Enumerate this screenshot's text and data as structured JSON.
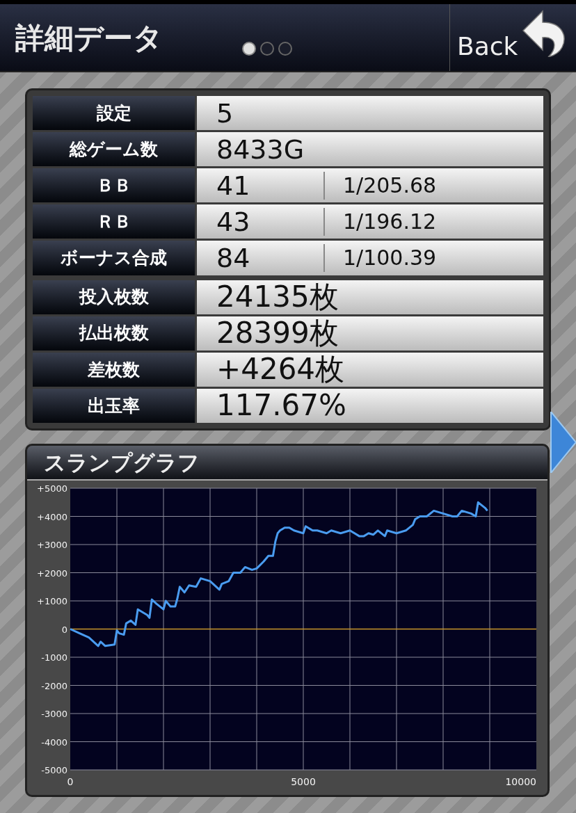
{
  "header": {
    "title": "詳細データ",
    "pages": [
      {
        "selected": true
      },
      {
        "selected": false
      },
      {
        "selected": false
      }
    ],
    "back_button": "Back"
  },
  "table": {
    "rows": [
      {
        "label": "設定",
        "value": "5",
        "kind": "game"
      },
      {
        "label": "総ゲーム数",
        "value": "8433G",
        "kind": "game"
      },
      {
        "label": "ＢＢ",
        "value": "41",
        "ratio": "1/205.68",
        "kind": "game"
      },
      {
        "label": "ＲＢ",
        "value": "43",
        "ratio": "1/196.12",
        "kind": "game"
      },
      {
        "label": "ボーナス合成",
        "value": "84",
        "ratio": "1/100.39",
        "kind": "game"
      },
      {
        "label": "投入枚数",
        "value": "24135枚",
        "kind": "medal"
      },
      {
        "label": "払出枚数",
        "value": "28399枚",
        "kind": "medal"
      },
      {
        "label": "差枚数",
        "value": "+4264枚",
        "kind": "medal"
      },
      {
        "label": "出玉率",
        "value": "117.67%",
        "kind": "medal"
      }
    ]
  },
  "graph": {
    "title": "スランプグラフ",
    "chart_data": {
      "type": "line",
      "grid": true,
      "ref_lines": [
        {
          "axis": "y",
          "value": 0,
          "color": "#c8962a"
        }
      ],
      "xlim": [
        0,
        10000
      ],
      "ylim": [
        -5000,
        5000
      ],
      "xticks": [
        0,
        5000,
        10000
      ],
      "yticks": [
        {
          "value": 5000,
          "label": "+5000"
        },
        {
          "value": 4000,
          "label": "+4000"
        },
        {
          "value": 3000,
          "label": "+3000"
        },
        {
          "value": 2000,
          "label": "+2000"
        },
        {
          "value": 1000,
          "label": "+1000"
        },
        {
          "value": 0,
          "label": "0"
        },
        {
          "value": -1000,
          "label": "-1000"
        },
        {
          "value": -2000,
          "label": "-2000"
        },
        {
          "value": -3000,
          "label": "-3000"
        },
        {
          "value": -4000,
          "label": "-4000"
        },
        {
          "value": -5000,
          "label": "-5000"
        }
      ],
      "x": [
        0,
        200,
        400,
        600,
        650,
        750,
        950,
        1000,
        1050,
        1150,
        1200,
        1300,
        1400,
        1450,
        1650,
        1700,
        1750,
        1850,
        2000,
        2050,
        2150,
        2250,
        2300,
        2350,
        2450,
        2550,
        2700,
        2800,
        3000,
        3200,
        3250,
        3400,
        3500,
        3650,
        3750,
        3900,
        4000,
        4150,
        4250,
        4350,
        4400,
        4450,
        4500,
        4600,
        4700,
        4800,
        5000,
        5050,
        5200,
        5300,
        5500,
        5600,
        5800,
        6000,
        6200,
        6300,
        6400,
        6500,
        6600,
        6750,
        6800,
        7000,
        7200,
        7350,
        7400,
        7500,
        7650,
        7800,
        8000,
        8200,
        8300,
        8400,
        8600,
        8700,
        8750,
        8900,
        8950
      ],
      "series": [
        {
          "color": "#4a9cf0",
          "values": [
            0,
            -150,
            -300,
            -600,
            -450,
            -600,
            -550,
            -50,
            -150,
            -200,
            200,
            300,
            150,
            700,
            500,
            400,
            1050,
            900,
            700,
            1000,
            800,
            800,
            1100,
            1500,
            1300,
            1550,
            1500,
            1800,
            1700,
            1400,
            1600,
            1700,
            2000,
            2000,
            2200,
            2100,
            2150,
            2400,
            2600,
            2600,
            3100,
            3400,
            3500,
            3600,
            3600,
            3500,
            3400,
            3650,
            3500,
            3500,
            3400,
            3500,
            3400,
            3500,
            3300,
            3300,
            3400,
            3350,
            3500,
            3300,
            3500,
            3400,
            3500,
            3700,
            3900,
            4000,
            4000,
            4200,
            4100,
            4000,
            4000,
            4200,
            4100,
            4000,
            4500,
            4300,
            4200
          ]
        }
      ]
    }
  }
}
